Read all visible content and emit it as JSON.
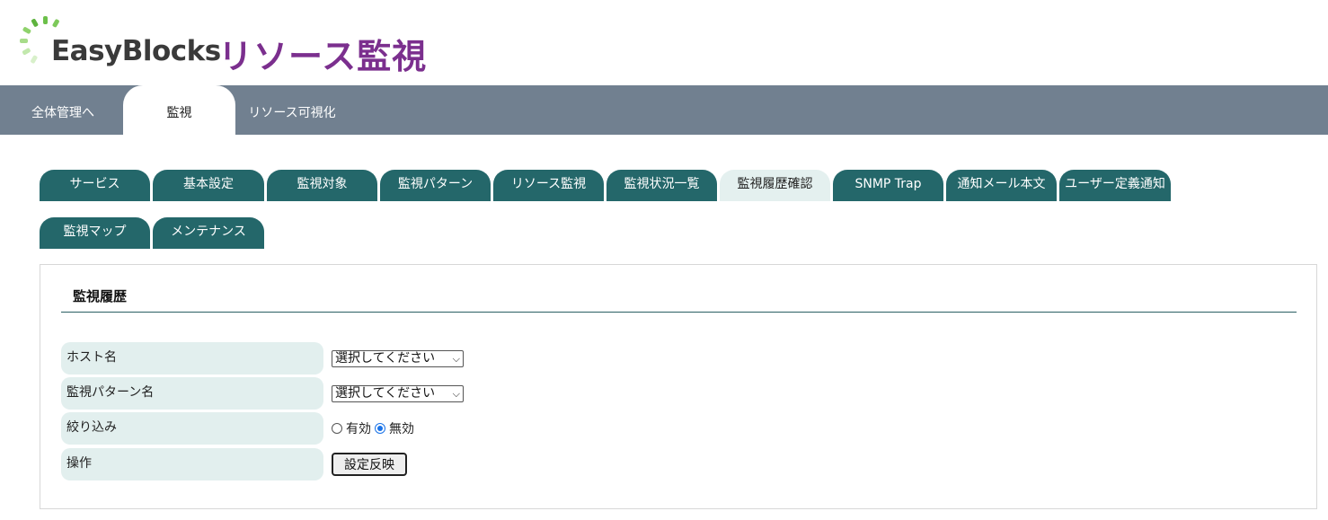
{
  "header": {
    "logo_text": "EasyBlocks",
    "app_title": "リソース監視"
  },
  "top_nav": [
    {
      "label": "全体管理へ",
      "active": false
    },
    {
      "label": "監視",
      "active": true
    },
    {
      "label": "リソース可視化",
      "active": false
    }
  ],
  "sub_tabs": [
    {
      "label": "サービス",
      "active": false
    },
    {
      "label": "基本設定",
      "active": false
    },
    {
      "label": "監視対象",
      "active": false
    },
    {
      "label": "監視パターン",
      "active": false
    },
    {
      "label": "リソース監視",
      "active": false
    },
    {
      "label": "監視状況一覧",
      "active": false
    },
    {
      "label": "監視履歴確認",
      "active": true
    },
    {
      "label": "SNMP Trap",
      "active": false
    },
    {
      "label": "通知メール本文",
      "active": false
    },
    {
      "label": "ユーザー定義通知",
      "active": false
    },
    {
      "label": "監視マップ",
      "active": false
    },
    {
      "label": "メンテナンス",
      "active": false
    }
  ],
  "panel": {
    "title": "監視履歴",
    "rows": {
      "host": {
        "label": "ホスト名",
        "select_value": "選択してください"
      },
      "pattern": {
        "label": "監視パターン名",
        "select_value": "選択してください"
      },
      "filter": {
        "label": "絞り込み",
        "options": [
          {
            "label": "有効",
            "checked": false
          },
          {
            "label": "無効",
            "checked": true
          }
        ]
      },
      "action": {
        "label": "操作",
        "button_label": "設定反映"
      }
    }
  },
  "colors": {
    "top_nav_bg": "#718090",
    "sub_tab_bg": "#24676a",
    "sub_tab_active_bg": "#e4f0ef",
    "label_bg": "#e2efee",
    "title_purple": "#7b2f8e",
    "radio_accent": "#1a73e8"
  }
}
